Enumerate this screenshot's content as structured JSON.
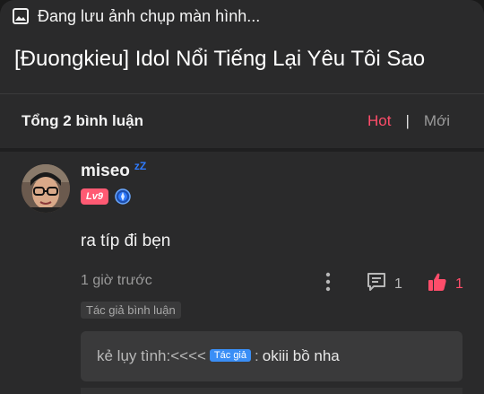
{
  "status_bar": {
    "message": "Đang lưu ảnh chụp màn hình...",
    "icon": "image-icon"
  },
  "story": {
    "title": "[Ɖuongkieu] Idol Nổi Tiếng Lại Yêu Tôi Sao"
  },
  "comments_header": {
    "count_label": "Tổng 2 bình luận",
    "sort_hot": "Hot",
    "sort_separator": "|",
    "sort_new": "Mới",
    "active_sort": "Hot",
    "accent_color": "#ff4d6a"
  },
  "comment": {
    "username": "miseo",
    "status_icon": "zz-sleep-icon",
    "status_text": "zZ",
    "level": "Lv9",
    "medal_icon": "blue-medal-icon",
    "text": "ra típ đi bẹn",
    "time": "1 giờ trước",
    "reply_count": "1",
    "like_count": "1",
    "author_tag": "Tác giả bình luận",
    "reply": {
      "user": "kẻ lụy tình:<<<<",
      "tag": "Tác giả",
      "separator": ":",
      "text": "okiii bồ nha"
    }
  }
}
